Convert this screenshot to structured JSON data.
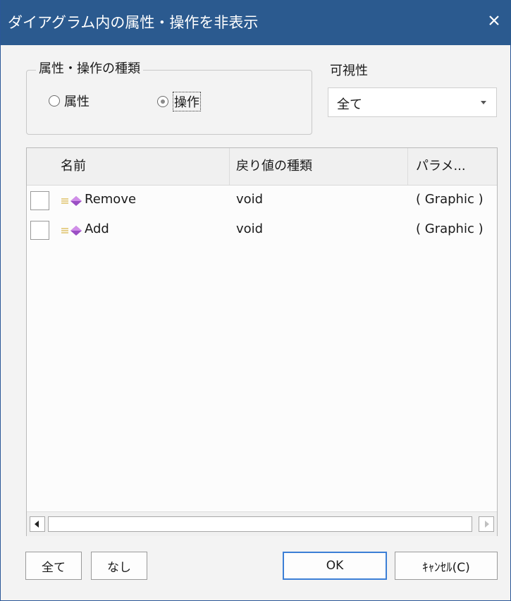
{
  "window": {
    "title": "ダイアグラム内の属性・操作を非表示"
  },
  "kind_group": {
    "legend": "属性・操作の種類",
    "options": [
      {
        "label": "属性",
        "checked": false
      },
      {
        "label": "操作",
        "checked": true
      }
    ]
  },
  "visibility": {
    "label": "可視性",
    "selected": "全て"
  },
  "list": {
    "columns": [
      "名前",
      "戻り値の種類",
      "パラメ..."
    ],
    "rows": [
      {
        "checked": false,
        "name": "Remove",
        "type": "void",
        "params": "( Graphic )",
        "icon": "operation-icon"
      },
      {
        "checked": false,
        "name": "Add",
        "type": "void",
        "params": "( Graphic )",
        "icon": "operation-icon"
      }
    ]
  },
  "buttons": {
    "all": "全て",
    "none": "なし",
    "ok": "OK",
    "cancel": "ｷｬﾝｾﾙ(C)"
  },
  "colors": {
    "titlebar": "#2b5a8f",
    "ok_border": "#3c7fd6"
  }
}
